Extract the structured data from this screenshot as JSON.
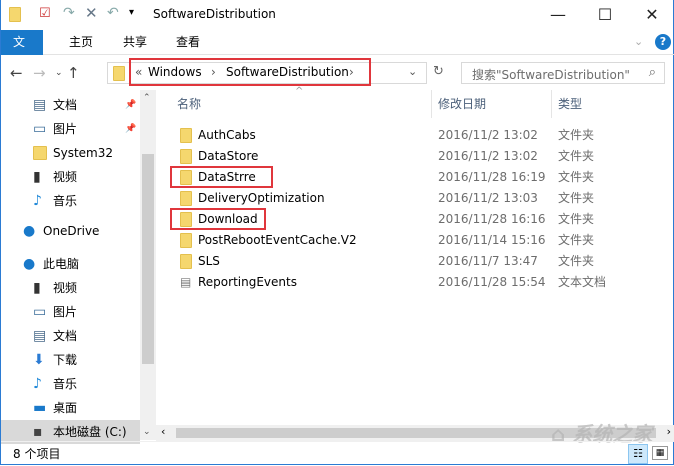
{
  "window": {
    "title": "SoftwareDistribution"
  },
  "ribbon": {
    "tabs": [
      "文件",
      "主页",
      "共享",
      "查看"
    ]
  },
  "address": {
    "overflow": "«",
    "crumbs": [
      "Windows",
      "SoftwareDistribution"
    ],
    "search_placeholder": "搜索\"SoftwareDistribution\""
  },
  "nav": {
    "quick": [
      {
        "label": "文档",
        "icon": "document-icon",
        "pinned": true
      },
      {
        "label": "图片",
        "icon": "picture-icon",
        "pinned": true
      },
      {
        "label": "System32",
        "icon": "folder-icon"
      },
      {
        "label": "视频",
        "icon": "video-icon"
      },
      {
        "label": "音乐",
        "icon": "music-icon"
      }
    ],
    "onedrive": "OneDrive",
    "pc": "此电脑",
    "pc_items": [
      {
        "label": "视频",
        "icon": "video-icon"
      },
      {
        "label": "图片",
        "icon": "picture-icon"
      },
      {
        "label": "文档",
        "icon": "document-icon"
      },
      {
        "label": "下载",
        "icon": "download-icon"
      },
      {
        "label": "音乐",
        "icon": "music-icon"
      },
      {
        "label": "桌面",
        "icon": "desktop-icon"
      },
      {
        "label": "本地磁盘 (C:)",
        "icon": "drive-icon"
      }
    ]
  },
  "columns": {
    "name": "名称",
    "date": "修改日期",
    "type": "类型"
  },
  "files": [
    {
      "name": "AuthCabs",
      "date": "2016/11/2 13:02",
      "type": "文件夹",
      "icon": "folder",
      "highlight": false
    },
    {
      "name": "DataStore",
      "date": "2016/11/2 13:02",
      "type": "文件夹",
      "icon": "folder",
      "highlight": false
    },
    {
      "name": "DataStrre",
      "date": "2016/11/28 16:19",
      "type": "文件夹",
      "icon": "folder",
      "highlight": true
    },
    {
      "name": "DeliveryOptimization",
      "date": "2016/11/2 13:03",
      "type": "文件夹",
      "icon": "folder",
      "highlight": false
    },
    {
      "name": "Download",
      "date": "2016/11/28 16:16",
      "type": "文件夹",
      "icon": "folder",
      "highlight": true
    },
    {
      "name": "PostRebootEventCache.V2",
      "date": "2016/11/14 15:16",
      "type": "文件夹",
      "icon": "folder",
      "highlight": false
    },
    {
      "name": "SLS",
      "date": "2016/11/7 13:47",
      "type": "文件夹",
      "icon": "folder",
      "highlight": false
    },
    {
      "name": "ReportingEvents",
      "date": "2016/11/28 15:54",
      "type": "文本文档",
      "icon": "text",
      "highlight": false
    }
  ],
  "status": {
    "count": "8 个项目"
  },
  "watermark": "系统之家",
  "colors": {
    "accent": "#1979ca",
    "highlight": "#e0363c"
  }
}
